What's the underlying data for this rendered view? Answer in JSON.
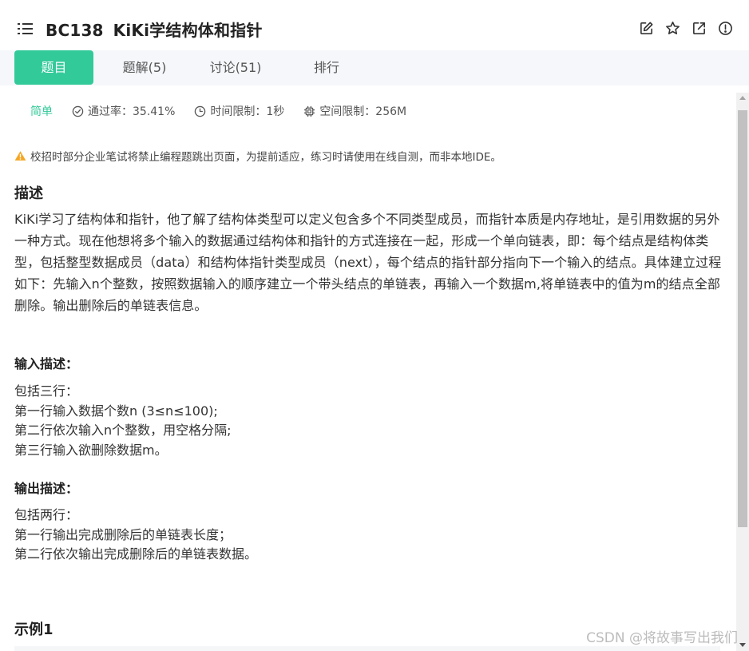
{
  "header": {
    "problem_code": "BC138",
    "problem_title": "KiKi学结构体和指针",
    "icons": [
      "menu-icon",
      "edit-icon",
      "star-icon",
      "external-link-icon",
      "report-icon"
    ]
  },
  "tabs": [
    {
      "label": "题目",
      "active": true
    },
    {
      "label": "题解(5)",
      "active": false
    },
    {
      "label": "讨论(51)",
      "active": false
    },
    {
      "label": "排行",
      "active": false
    }
  ],
  "meta": {
    "difficulty": "简单",
    "pass_rate": "通过率：35.41%",
    "time_limit": "时间限制：1秒",
    "space_limit": "空间限制：256M"
  },
  "notice": "校招时部分企业笔试将禁止编程题跳出页面，为提前适应，练习时请使用在线自测，而非本地IDE。",
  "description": {
    "heading": "描述",
    "text": "KiKi学习了结构体和指针，他了解了结构体类型可以定义包含多个不同类型成员，而指针本质是内存地址，是引用数据的另外一种方式。现在他想将多个输入的数据通过结构体和指针的方式连接在一起，形成一个单向链表，即：每个结点是结构体类型，包括整型数据成员（data）和结构体指针类型成员（next），每个结点的指针部分指向下一个输入的结点。具体建立过程如下：先输入n个整数，按照数据输入的顺序建立一个带头结点的单链表，再输入一个数据m,将单链表中的值为m的结点全部删除。输出删除后的单链表信息。"
  },
  "input": {
    "heading": "输入描述：",
    "lines": [
      "包括三行：",
      "第一行输入数据个数n (3≤n≤100);",
      "第二行依次输入n个整数，用空格分隔;",
      "第三行输入欲删除数据m。"
    ]
  },
  "output": {
    "heading": "输出描述：",
    "lines": [
      "包括两行：",
      "第一行输出完成删除后的单链表长度；",
      "第二行依次输出完成删除后的单链表数据。"
    ]
  },
  "example": {
    "heading": "示例1"
  },
  "watermark": "CSDN @将故事写出我们",
  "colors": {
    "accent": "#32ca99",
    "tabbar_bg": "#f5f7fa",
    "warning": "#f5a623"
  }
}
